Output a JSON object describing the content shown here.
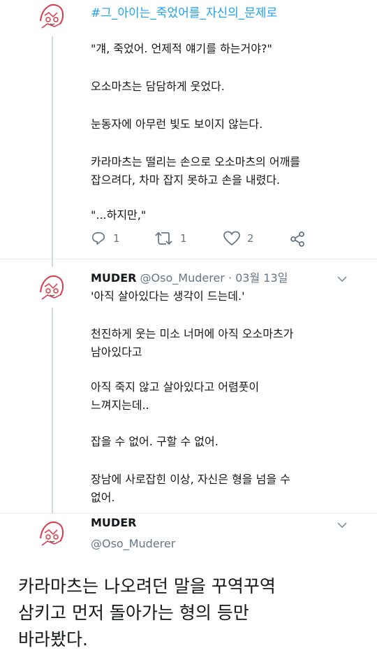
{
  "tweet1": {
    "hashtag": "#그_아이는_죽었어를_자신의_문제로",
    "lines": [
      "\"걔, 죽었어. 언제적 얘기를 하는거야?\"",
      "오소마츠는 담담하게 웃었다.",
      "눈동자에 아무런 빛도 보이지 않는다.",
      "카라마츠는 떨리는 손으로 오소마츠의 어깨를",
      "잡으려다, 차마 잡지 못하고 손을 내렸다.",
      "\"...하지만,\""
    ],
    "actions": {
      "reply_icon": "reply-icon",
      "reply_count": "1",
      "retweet_icon": "retweet-icon",
      "retweet_count": "1",
      "like_icon": "heart-icon",
      "like_count": "2",
      "share_icon": "share-icon"
    }
  },
  "tweet2": {
    "name": "MUDER",
    "handle_date": "@Oso_Muderer · 03월 13일",
    "lines": [
      "'아직 살아있다는 생각이 드는데.'",
      "천진하게 웃는 미소 너머에 아직 오소마츠가",
      "남아있다고",
      "아직 죽지 않고 살아있다고 어렴풋이",
      "느껴지는데..",
      "잡을 수 없어. 구할 수 없어.",
      "장남에 사로잡힌 이상, 자신은 형을 넘을 수",
      "없어."
    ]
  },
  "tweet3": {
    "name": "MUDER",
    "handle": "@Oso_Muderer",
    "big_lines": [
      "카라마츠는 나오려던 말을 꾸역꾸역",
      "삼키고 먼저 돌아가는 형의 등만",
      "바라봤다."
    ]
  },
  "colors": {
    "accent": "#1da1f2",
    "muted": "#657786",
    "text": "#14171a",
    "avatar_art": "#d9394a"
  }
}
